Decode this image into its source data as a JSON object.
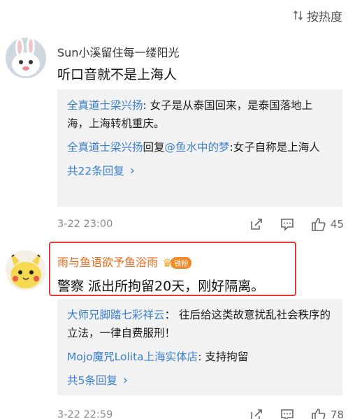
{
  "sort": {
    "icon": "sort-icon",
    "label": "按热度"
  },
  "comments": [
    {
      "avatar_icon": "rabbit-avatar",
      "username": "Sun小溪留住每一缕阳光",
      "text": "听口音就不是上海人",
      "replies": [
        {
          "user": "全真道士梁兴扬",
          "sep": ": ",
          "content": "女子是从泰国回来，是泰国落地上海，上海转机重庆。"
        },
        {
          "user": "全真道士梁兴扬",
          "mid": "回复",
          "target": "@鱼水中的梦",
          "sep": ":",
          "content": "女子自称是上海人"
        }
      ],
      "more": "共22条回复",
      "time": "3-22 23:00",
      "likes": "45"
    },
    {
      "avatar_icon": "pikachu-avatar",
      "username": "雨与鱼语欲予鱼浴雨",
      "badge": "铁粉",
      "text": "警察 派出所拘留20天，刚好隔离。",
      "replies": [
        {
          "user": "大师兄脚踏七彩祥云",
          "sep": "： ",
          "content": "往后给这类故意扰乱社会秩序的立法，一律自费服刑！"
        },
        {
          "user": "Mojo魔咒Lolita上海实体店",
          "sep": ": ",
          "content": "支持拘留"
        }
      ],
      "more": "共5条回复",
      "time": "3-22 22:59",
      "likes": "78"
    }
  ],
  "colors": {
    "link": "#3a7fcf",
    "username_highlight": "#f06a1a",
    "highlight_border": "#e23c35",
    "reply_bg": "#f2f2f2"
  }
}
